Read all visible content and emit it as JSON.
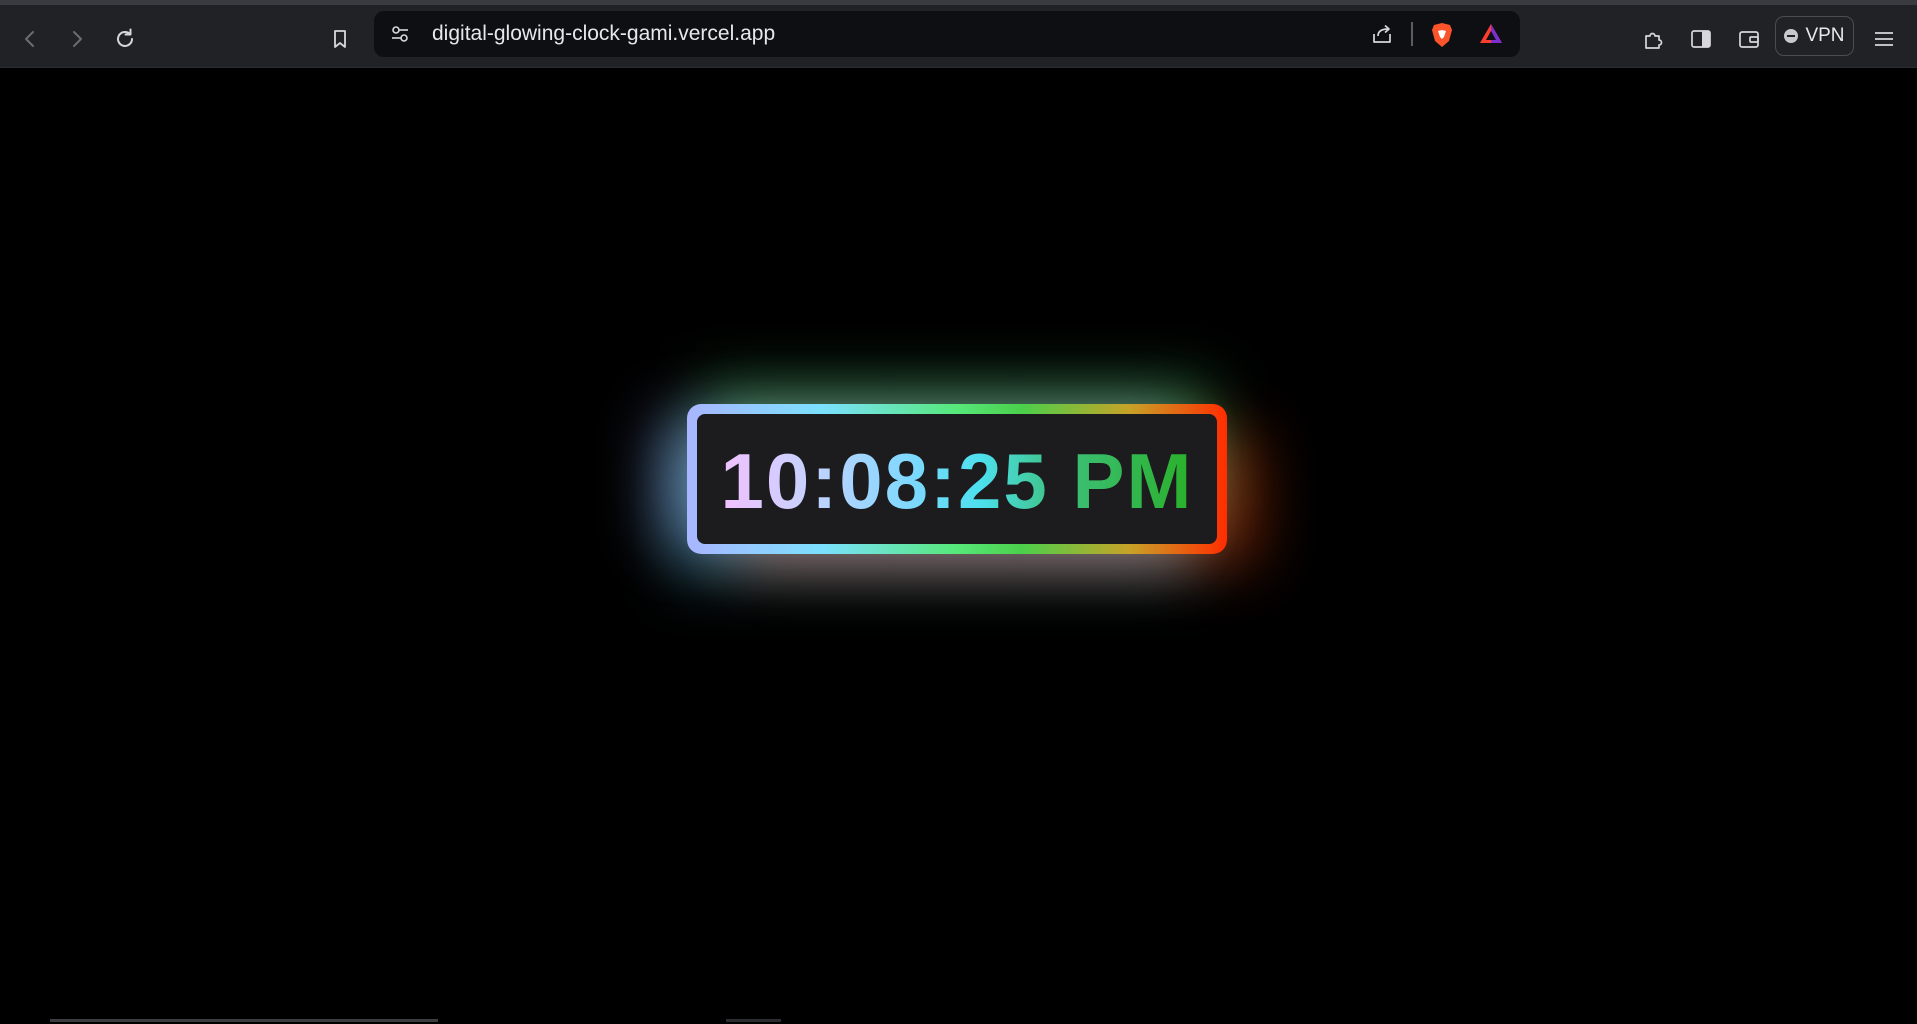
{
  "browser": {
    "url": "digital-glowing-clock-gami.vercel.app",
    "vpn_label": "VPN",
    "icons": [
      "back-icon",
      "forward-icon",
      "reload-icon",
      "bookmark-icon",
      "site-settings-icon",
      "share-icon",
      "brave-shields-icon",
      "brave-rewards-icon",
      "extensions-icon",
      "sidebar-icon",
      "wallet-icon",
      "menu-icon"
    ]
  },
  "clock": {
    "time": "10:08:25 PM",
    "colors": {
      "border_start": "#a9b6ff",
      "border_mid": "#56e87a",
      "border_end": "#ff2d00",
      "inner_bg": "#1c1c1e",
      "page_bg": "#000000"
    }
  }
}
